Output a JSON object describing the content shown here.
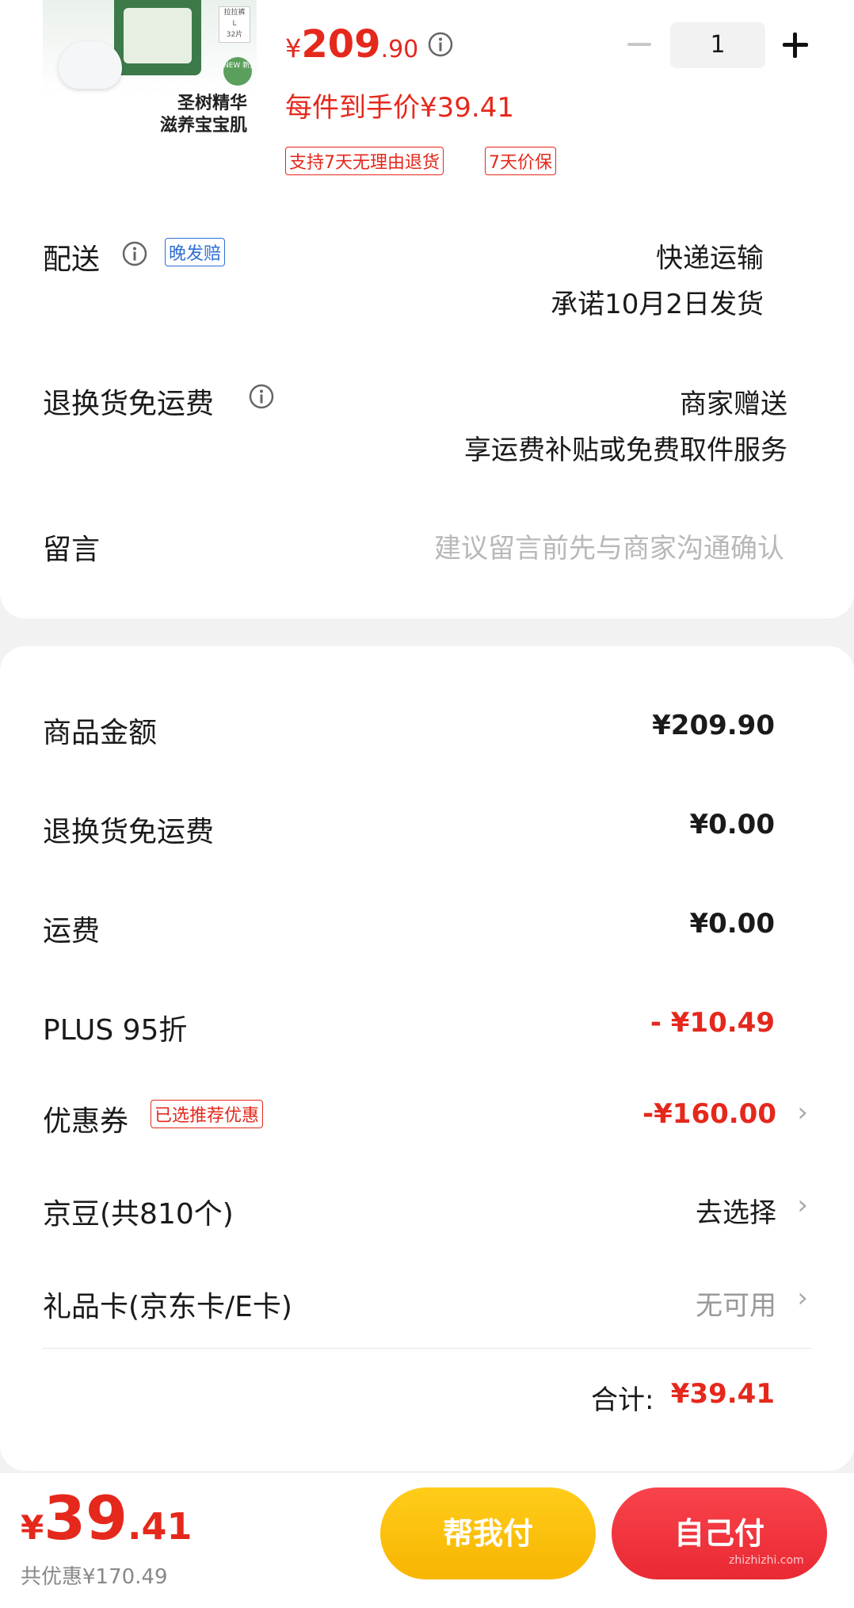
{
  "product": {
    "image_text_line1": "圣树精华",
    "image_text_line2": "滋养宝宝肌",
    "image_tag_line1": "拉拉裤",
    "image_tag_line2": "L",
    "image_tag_line3": "32片",
    "image_badge": "NEW 新升级",
    "price_symbol": "¥",
    "price_int": "209",
    "price_dec": ".90",
    "per_item_price": "每件到手价¥39.41",
    "tags": [
      "支持7天无理由退货",
      "7天价保"
    ],
    "quantity": "1"
  },
  "delivery": {
    "label": "配送",
    "badge": "晚发赔",
    "method": "快递运输",
    "promise": "承诺10月2日发货"
  },
  "return_freight": {
    "label": "退换货免运费",
    "value": "商家赠送",
    "sub": "享运费补贴或免费取件服务"
  },
  "message": {
    "label": "留言",
    "placeholder": "建议留言前先与商家沟通确认"
  },
  "summary": {
    "rows": [
      {
        "label": "商品金额",
        "value": "¥209.90"
      },
      {
        "label": "退换货免运费",
        "value": "¥0.00"
      },
      {
        "label": "运费",
        "value": "¥0.00"
      },
      {
        "label": "PLUS 95折",
        "value": "- ¥10.49"
      }
    ],
    "coupon": {
      "label": "优惠券",
      "badge": "已选推荐优惠",
      "value": "-¥160.00"
    },
    "jingdou": {
      "label": "京豆(共810个)",
      "value": "去选择"
    },
    "giftcard": {
      "label": "礼品卡(京东卡/E卡)",
      "value": "无可用"
    },
    "total_label": "合计:",
    "total_value": "¥39.41"
  },
  "bottom": {
    "price_symbol": "¥",
    "price_int": "39",
    "price_dec": ".41",
    "saved": "共优惠¥170.49",
    "help_pay": "帮我付",
    "self_pay": "自己付",
    "watermark": "zhizhizhi.com"
  },
  "colors": {
    "accent_red": "#e5281c",
    "blue_tag": "#2e6fd6",
    "button_yellow": "#f7b500",
    "button_red": "#e92933"
  }
}
